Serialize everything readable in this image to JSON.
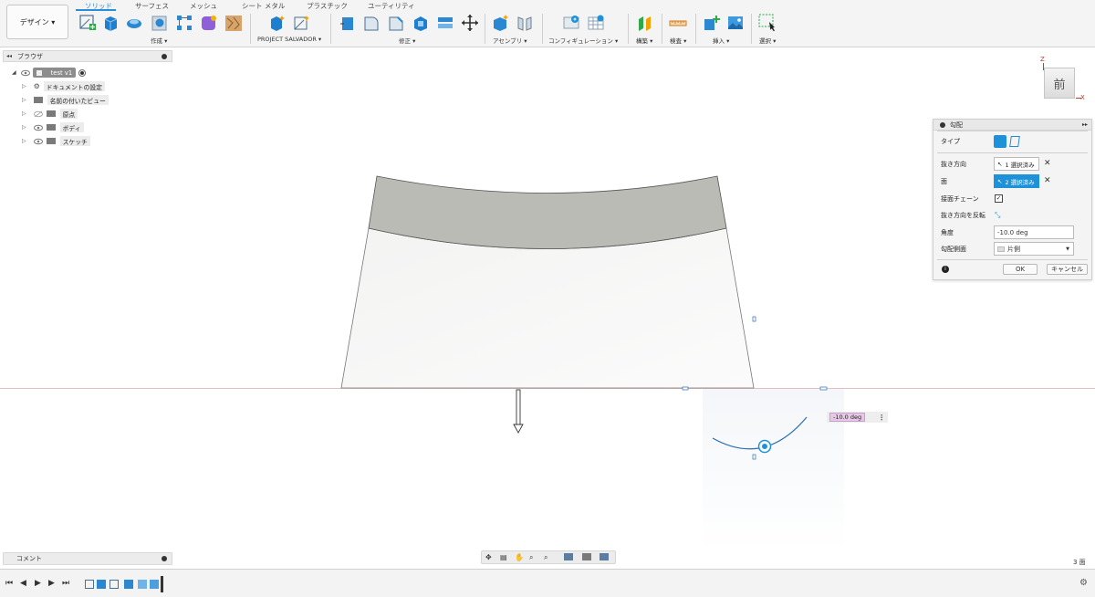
{
  "toolbar": {
    "workspace_label": "デザイン ▾",
    "tabs": [
      "ソリッド",
      "サーフェス",
      "メッシュ",
      "シート メタル",
      "プラスチック",
      "ユーティリティ"
    ],
    "groups": {
      "create": "作成 ▾",
      "project": "PROJECT SALVADOR ▾",
      "modify": "修正 ▾",
      "assemble": "アセンブリ ▾",
      "configure": "コンフィギュレーション ▾",
      "construct": "構築 ▾",
      "inspect": "検査 ▾",
      "insert": "挿入 ▾",
      "select": "選択 ▾"
    }
  },
  "browser": {
    "title": "ブラウザ",
    "root": "test v1",
    "items": [
      "ドキュメントの設定",
      "名前の付いたビュー",
      "原点",
      "ボディ",
      "スケッチ"
    ]
  },
  "comment": {
    "label": "コメント"
  },
  "viewcube": {
    "face": "前",
    "axis_z": "Z",
    "axis_x": "X"
  },
  "draft": {
    "title": "勾配",
    "type_label": "タイプ",
    "pull_direction_label": "抜き方向",
    "pull_direction_value": "1 選択済み",
    "faces_label": "面",
    "faces_value": "2 選択済み",
    "tangent_chain_label": "接面チェーン",
    "flip_label": "抜き方向を反転",
    "angle_label": "角度",
    "angle_value": "-10.0 deg",
    "draft_side_label": "勾配側面",
    "draft_side_value": "片側",
    "ok": "OK",
    "cancel": "キャンセル"
  },
  "angle_manipulator": "-10.0 deg",
  "face_count": "3 面",
  "colors": {
    "accent": "#1e92d9",
    "top_face": "#b9bbb4",
    "body": "#f6f6f5"
  }
}
